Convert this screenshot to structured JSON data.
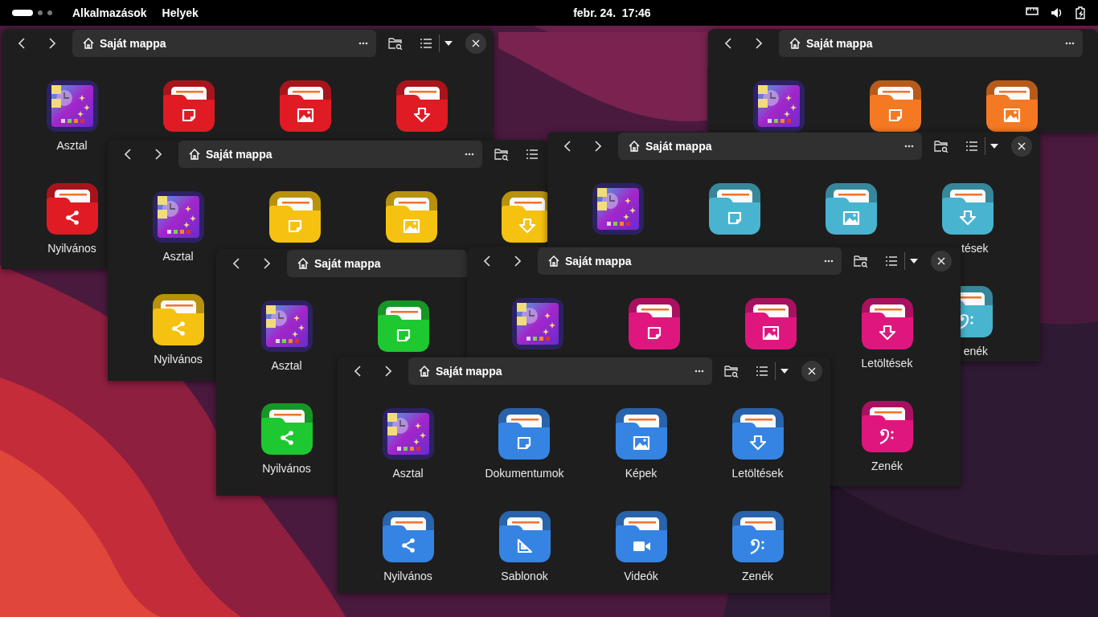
{
  "top_bar": {
    "menus": [
      "Alkalmazások",
      "Helyek"
    ],
    "clock": "febr. 24.  17:46"
  },
  "windows": [
    {
      "title": "Saját mappa",
      "color": "#e01b24",
      "rows": [
        [
          {
            "kind": "desktop",
            "label": "Asztal"
          },
          {
            "kind": "documents"
          },
          {
            "kind": "pictures"
          },
          {
            "kind": "downloads"
          }
        ],
        [
          {
            "kind": "public",
            "label": "Nyilvános"
          }
        ]
      ]
    },
    {
      "title": "Saját mappa",
      "color": "#f57923",
      "rows": [
        [
          {
            "kind": "desktop"
          },
          {
            "kind": "documents"
          },
          {
            "kind": "pictures"
          }
        ]
      ]
    },
    {
      "title": "Saját mappa",
      "color": "#f5c211",
      "rows": [
        [
          {
            "kind": "desktop",
            "label": "Asztal"
          },
          {
            "kind": "documents"
          },
          {
            "kind": "pictures"
          },
          {
            "kind": "downloads"
          }
        ],
        [
          {
            "kind": "public",
            "label": "Nyilvános"
          }
        ]
      ]
    },
    {
      "title": "Saját mappa",
      "color": "#49b4cf",
      "rows": [
        [
          {
            "kind": "desktop"
          },
          {
            "kind": "documents"
          },
          {
            "kind": "pictures"
          },
          {
            "kind": "downloads",
            "label": "tések",
            "label_clipped": true
          }
        ],
        [
          null,
          null,
          null,
          {
            "kind": "music",
            "label": "enék",
            "label_clipped": true
          }
        ]
      ]
    },
    {
      "title": "Saját mappa",
      "color": "#1ec831",
      "rows": [
        [
          {
            "kind": "desktop",
            "label": "Asztal"
          },
          {
            "kind": "documents"
          }
        ],
        [
          {
            "kind": "public",
            "label": "Nyilvános"
          }
        ]
      ]
    },
    {
      "title": "Saját mappa",
      "color": "#e0167f",
      "rows": [
        [
          {
            "kind": "desktop"
          },
          {
            "kind": "documents"
          },
          {
            "kind": "pictures"
          },
          {
            "kind": "downloads",
            "label": "Letöltések"
          }
        ],
        [
          null,
          null,
          null,
          {
            "kind": "music",
            "label": "Zenék"
          }
        ]
      ]
    },
    {
      "title": "Saját mappa",
      "color": "#3584e4",
      "rows": [
        [
          {
            "kind": "desktop",
            "label": "Asztal"
          },
          {
            "kind": "documents",
            "label": "Dokumentumok"
          },
          {
            "kind": "pictures",
            "label": "Képek"
          },
          {
            "kind": "downloads",
            "label": "Letöltések"
          }
        ],
        [
          {
            "kind": "public",
            "label": "Nyilvános"
          },
          {
            "kind": "templates",
            "label": "Sablonok"
          },
          {
            "kind": "videos",
            "label": "Videók"
          },
          {
            "kind": "music",
            "label": "Zenék"
          }
        ]
      ]
    }
  ]
}
